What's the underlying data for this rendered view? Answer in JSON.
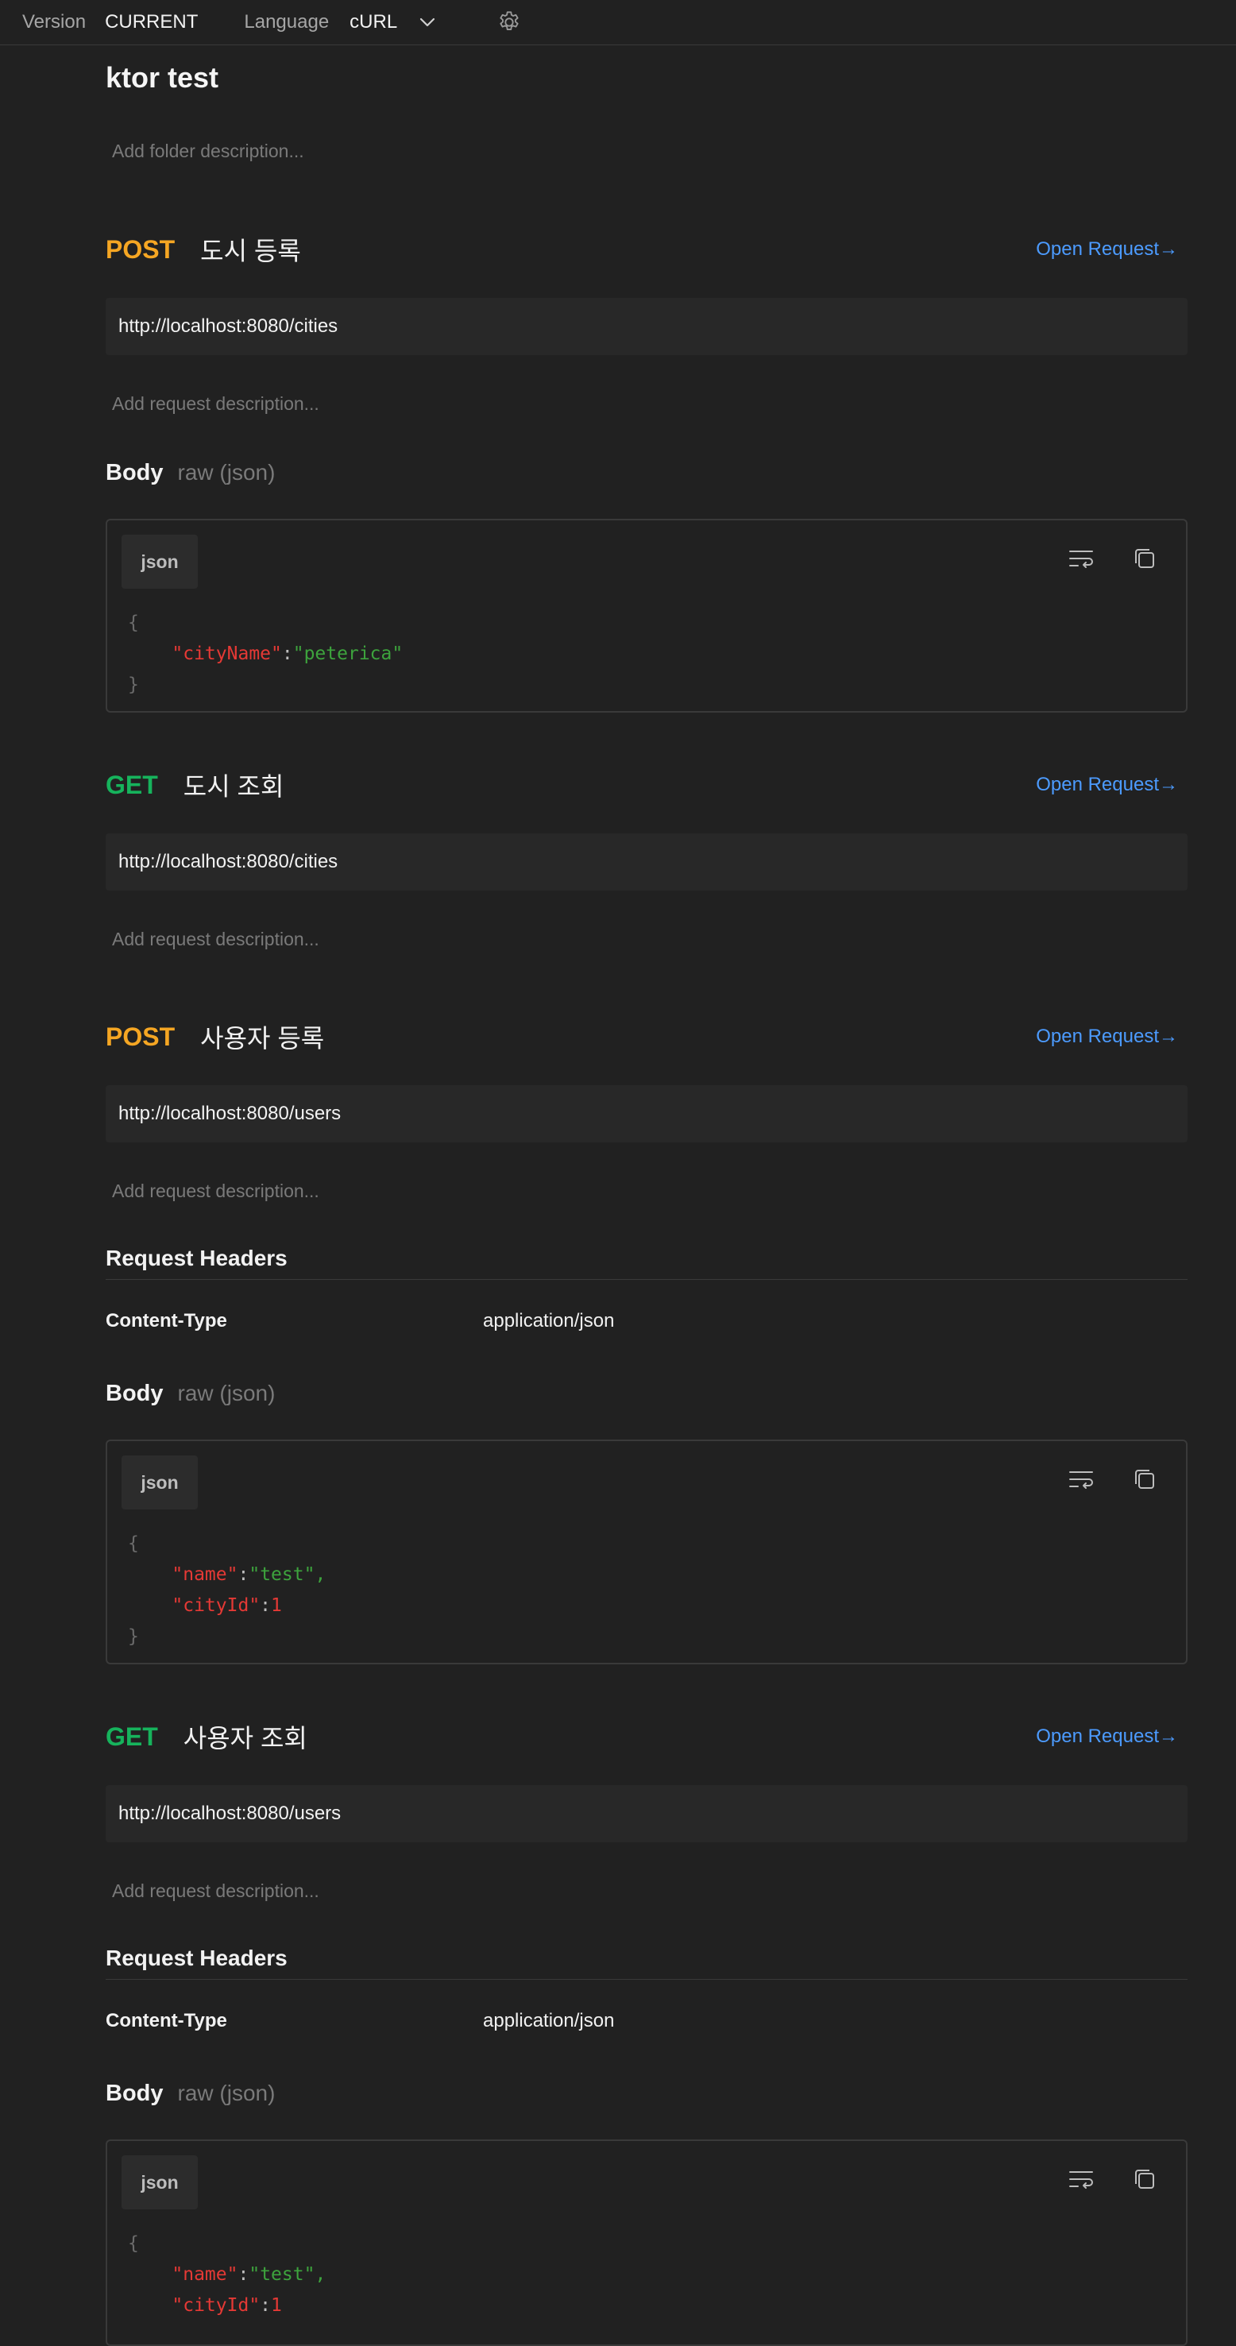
{
  "topbar": {
    "version_label": "Version",
    "version_value": "CURRENT",
    "language_label": "Language",
    "language_value": "cURL"
  },
  "folder": {
    "title": "ktor test",
    "description_placeholder": "Add folder description..."
  },
  "colors": {
    "post": "#f5a623",
    "get": "#16b35c",
    "link": "#4c9bff"
  },
  "requests": [
    {
      "method": "POST",
      "name": "도시 등록",
      "open_label": "Open Request→",
      "url": "http://localhost:8080/cities",
      "description_placeholder": "Add request description...",
      "body_label": "Body",
      "body_type": "raw (json)",
      "body_lang": "json",
      "body_lines": {
        "open": "{",
        "l1_key": "\"cityName\"",
        "l1_colon": ":",
        "l1_val": "\"peterica\"",
        "close": "}"
      }
    },
    {
      "method": "GET",
      "name": "도시 조회",
      "open_label": "Open Request→",
      "url": "http://localhost:8080/cities",
      "description_placeholder": "Add request description..."
    },
    {
      "method": "POST",
      "name": "사용자 등록",
      "open_label": "Open Request→",
      "url": "http://localhost:8080/users",
      "description_placeholder": "Add request description...",
      "headers_title": "Request Headers",
      "header_key": "Content-Type",
      "header_value": "application/json",
      "body_label": "Body",
      "body_type": "raw (json)",
      "body_lang": "json",
      "body_lines": {
        "open": "{",
        "l1_key": "\"name\"",
        "l1_colon": ":",
        "l1_val": "\"test\"",
        "l1_comma": ",",
        "l2_key": "\"cityId\"",
        "l2_colon": ":",
        "l2_val": "1",
        "close": "}"
      }
    },
    {
      "method": "GET",
      "name": "사용자 조회",
      "open_label": "Open Request→",
      "url": "http://localhost:8080/users",
      "description_placeholder": "Add request description...",
      "headers_title": "Request Headers",
      "header_key": "Content-Type",
      "header_value": "application/json",
      "body_label": "Body",
      "body_type": "raw (json)",
      "body_lang": "json",
      "body_lines": {
        "open": "{",
        "l1_key": "\"name\"",
        "l1_colon": ":",
        "l1_val": "\"test\"",
        "l1_comma": ",",
        "l2_key": "\"cityId\"",
        "l2_colon": ":",
        "l2_val": "1"
      }
    }
  ],
  "icons": {
    "chevron": "chevron-down-icon",
    "settings": "gear-icon",
    "wrap": "wrap-lines-icon",
    "copy": "copy-icon"
  }
}
